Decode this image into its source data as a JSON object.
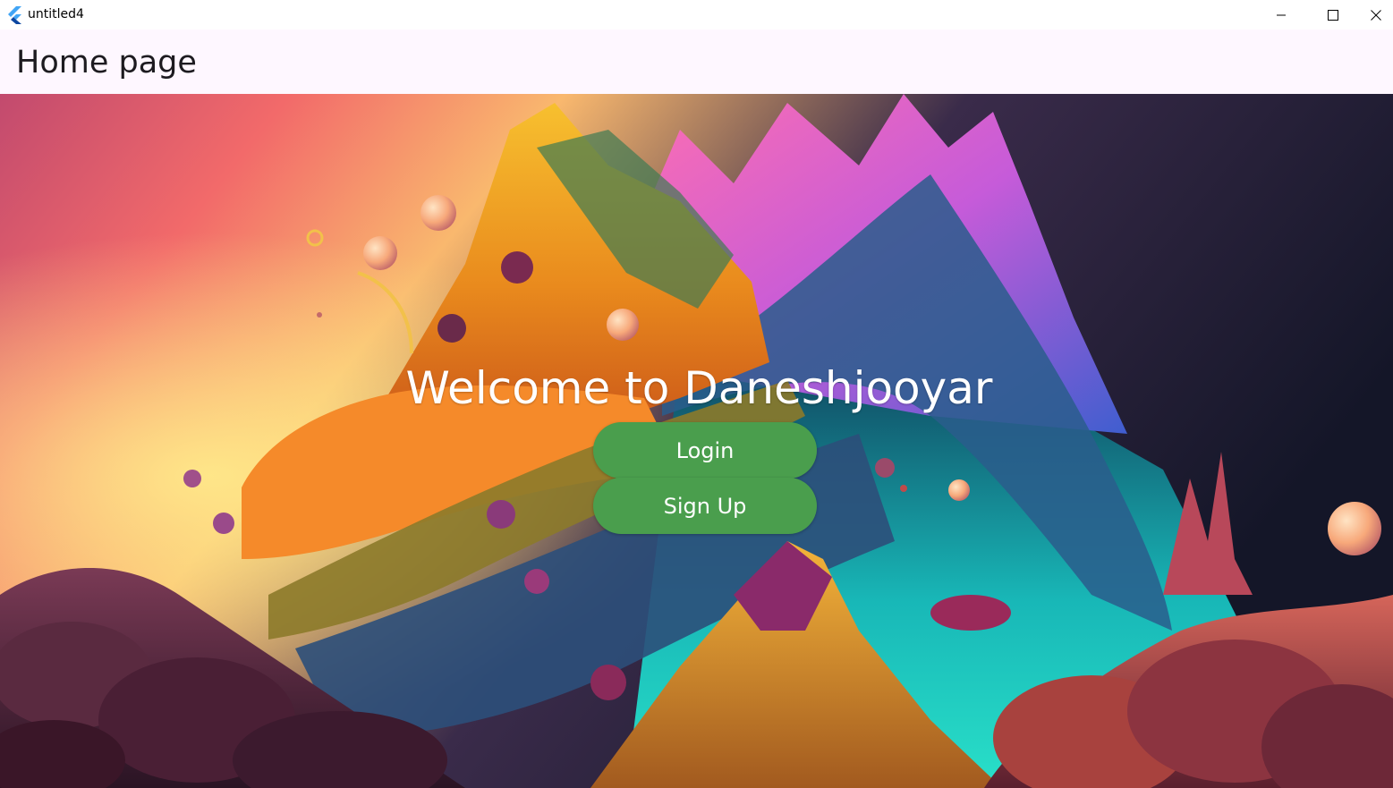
{
  "window": {
    "title": "untitled4",
    "app_icon": "flutter-icon",
    "controls": [
      "minimize-icon",
      "maximize-icon",
      "close-icon"
    ]
  },
  "appbar": {
    "title": "Home page",
    "background": "#fef7ff"
  },
  "main": {
    "welcome_text": "Welcome to Daneshjooyar",
    "login_label": "Login",
    "signup_label": "Sign Up",
    "button_color": "#4a9e4d",
    "background_image": "fantasy-landscape-artwork"
  }
}
